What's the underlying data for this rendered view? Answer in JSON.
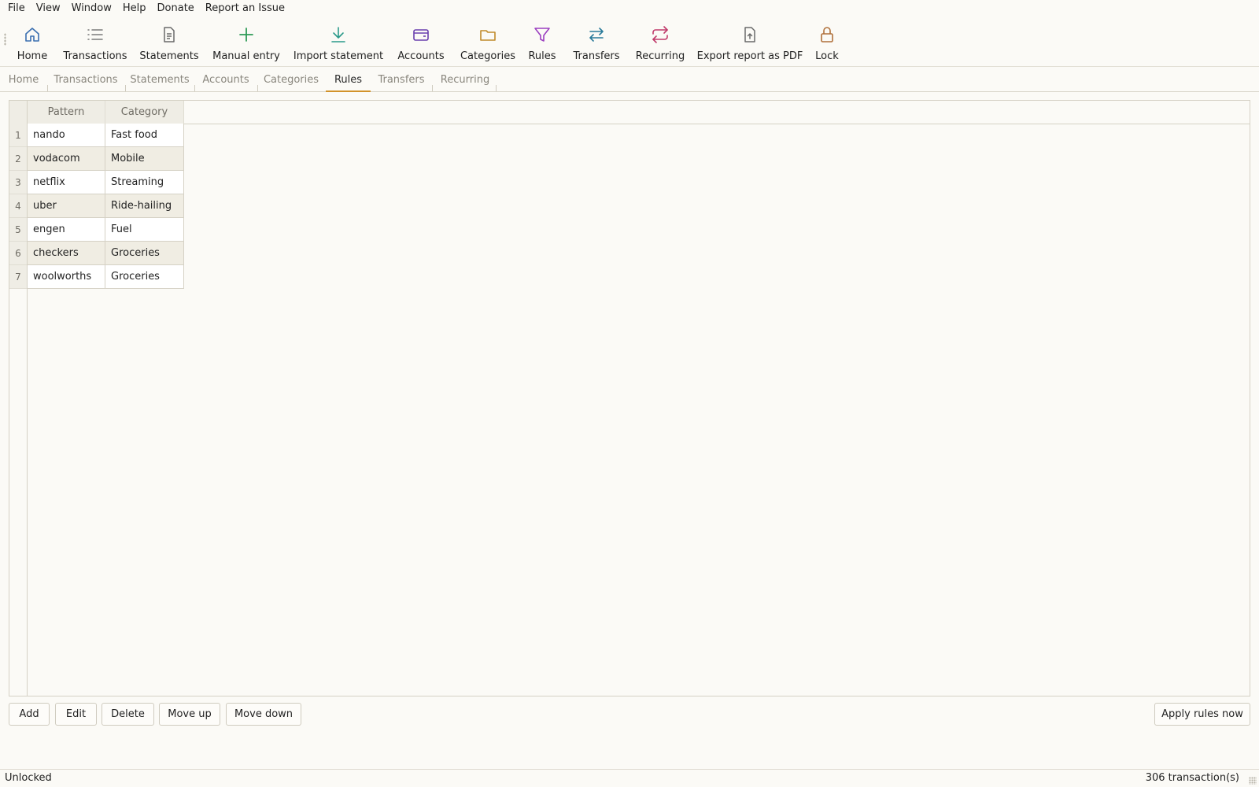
{
  "menu": {
    "items": [
      "File",
      "View",
      "Window",
      "Help",
      "Donate",
      "Report an Issue"
    ]
  },
  "toolbar": {
    "items": [
      {
        "label": "Home",
        "icon": "home-icon",
        "color": "#3b6fb0"
      },
      {
        "label": "Transactions",
        "icon": "list-icon",
        "color": "#7a7a7a"
      },
      {
        "label": "Statements",
        "icon": "document-icon",
        "color": "#6a6a6a"
      },
      {
        "label": "Manual entry",
        "icon": "plus-icon",
        "color": "#2e9b57"
      },
      {
        "label": "Import statement",
        "icon": "download-icon",
        "color": "#2a9a8a"
      },
      {
        "label": "Accounts",
        "icon": "wallet-icon",
        "color": "#6a3fae"
      },
      {
        "label": "Categories",
        "icon": "folder-icon",
        "color": "#c08a2a"
      },
      {
        "label": "Rules",
        "icon": "filter-icon",
        "color": "#9b3fc0"
      },
      {
        "label": "Transfers",
        "icon": "transfer-icon",
        "color": "#2a7a9a"
      },
      {
        "label": "Recurring",
        "icon": "repeat-icon",
        "color": "#c03a6a"
      },
      {
        "label": "Export report as PDF",
        "icon": "export-file-icon",
        "color": "#6a6a6a"
      },
      {
        "label": "Lock",
        "icon": "lock-icon",
        "color": "#b0703a"
      }
    ]
  },
  "tabs": {
    "items": [
      "Home",
      "Transactions",
      "Statements",
      "Accounts",
      "Categories",
      "Rules",
      "Transfers",
      "Recurring"
    ],
    "active": "Rules"
  },
  "rules_table": {
    "columns": [
      "Pattern",
      "Category"
    ],
    "rows": [
      {
        "num": "1",
        "pattern": "nando",
        "category": "Fast food"
      },
      {
        "num": "2",
        "pattern": "vodacom",
        "category": "Mobile"
      },
      {
        "num": "3",
        "pattern": "netflix",
        "category": "Streaming"
      },
      {
        "num": "4",
        "pattern": "uber",
        "category": "Ride-hailing"
      },
      {
        "num": "5",
        "pattern": "engen",
        "category": "Fuel"
      },
      {
        "num": "6",
        "pattern": "checkers",
        "category": "Groceries"
      },
      {
        "num": "7",
        "pattern": "woolworths",
        "category": "Groceries"
      }
    ]
  },
  "actions": {
    "add": "Add",
    "edit": "Edit",
    "delete": "Delete",
    "move_up": "Move up",
    "move_down": "Move down",
    "apply": "Apply rules now"
  },
  "status": {
    "left": "Unlocked",
    "right": "306 transaction(s)"
  },
  "colors": {
    "accent_tab_underline": "#d2922a",
    "background": "#fbfaf6"
  }
}
